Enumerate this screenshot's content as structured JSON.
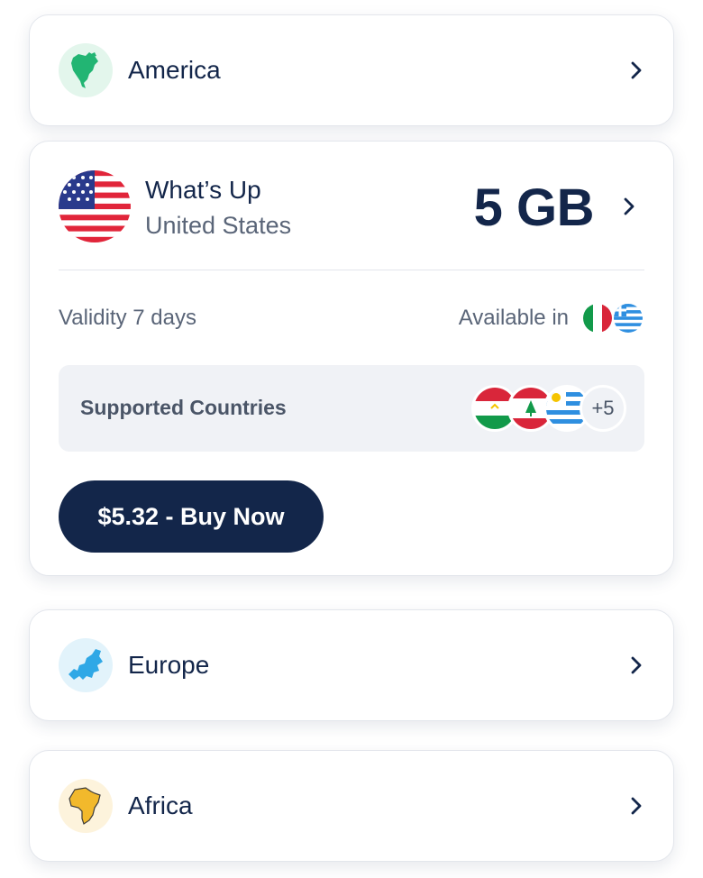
{
  "regions": {
    "america": {
      "label": "America",
      "icon": "north-america-map-icon",
      "bg": "#e3f6ec"
    },
    "europe": {
      "label": "Europe",
      "icon": "europe-map-icon",
      "bg": "#e2f3fb"
    },
    "africa": {
      "label": "Africa",
      "icon": "africa-map-icon",
      "bg": "#fdf3dc"
    }
  },
  "plan": {
    "name": "What’s Up",
    "country": "United States",
    "country_flag": "us-flag-icon",
    "data_amount": "5 GB",
    "validity": "Validity 7 days",
    "available_in_label": "Available in",
    "available_flags": [
      "italy-flag-icon",
      "greece-flag-icon"
    ],
    "supported_label": "Supported Countries",
    "supported_flags": [
      "tajikistan-flag-icon",
      "lebanon-flag-icon",
      "uruguay-flag-icon"
    ],
    "more_count": "+5",
    "buy_label": "$5.32 - Buy Now"
  },
  "colors": {
    "primary": "#13264a",
    "muted_text": "#5a6578",
    "panel": "#f0f2f6"
  }
}
